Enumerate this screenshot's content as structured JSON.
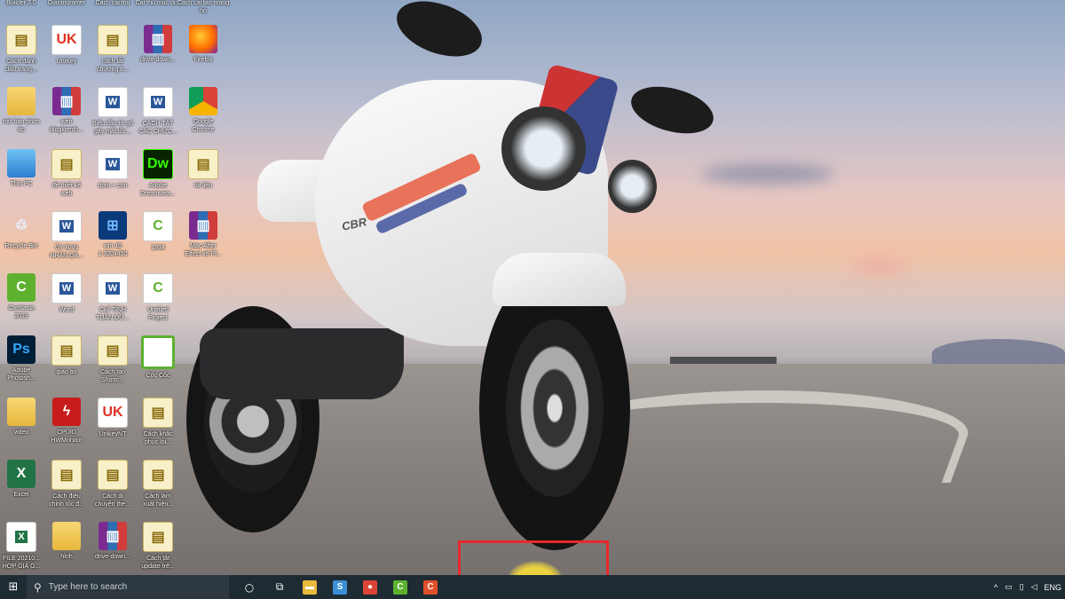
{
  "desktop": {
    "wallpaper": "motorcycle",
    "wallpaper_bike_badge": "CBR",
    "top_partial_labels": [
      "Builder 3.0",
      "Giantnummer",
      "Cach cai thu",
      "Cai thu muc di...",
      "Cach cai tao mang ho"
    ],
    "icons": [
      {
        "label": "Cách đánh\ndấu trang...",
        "icon": "folder-doc-icon"
      },
      {
        "label": "UniKey",
        "icon": "unikey-icon"
      },
      {
        "label": "cách tắt\nchương tr...",
        "icon": "folder-doc-icon"
      },
      {
        "label": "drive-down...",
        "icon": "winrar-icon"
      },
      {
        "label": "Firefox",
        "icon": "firefox-icon"
      },
      {
        "label": "mở bàn phím\nảo",
        "icon": "folder-icon"
      },
      {
        "label": "web\nblogkienth...",
        "icon": "winrar-icon"
      },
      {
        "label": "Biểu đầu từ gõ\ngây mất tốc...",
        "icon": "word-icon"
      },
      {
        "label": "CÁCH TẮT\nCÁC CHỨC...",
        "icon": "word-icon"
      },
      {
        "label": "Google\nChrome",
        "icon": "chrome-icon"
      },
      {
        "label": "This PC",
        "icon": "this-pc-icon"
      },
      {
        "label": "đề thiết kế\nweb",
        "icon": "folder-doc-icon"
      },
      {
        "label": "dom + con",
        "icon": "word-icon"
      },
      {
        "label": "Adobe\nDreamwea...",
        "icon": "dreamweaver-icon"
      },
      {
        "label": "tải liệu",
        "icon": "folder-doc-icon"
      },
      {
        "label": "Recycle Bin",
        "icon": "recycle-bin-icon"
      },
      {
        "label": "ỦY BAN\nNHÂN DÂ...",
        "icon": "word-icon"
      },
      {
        "label": "win 10\n1 920x450",
        "icon": "win10-icon"
      },
      {
        "label": "1934",
        "icon": "camtasia-project-icon"
      },
      {
        "label": "Mac After\nEffect vẽ Pl...",
        "icon": "winrar-icon"
      },
      {
        "label": "Camtasia\n2019",
        "icon": "camtasia-icon"
      },
      {
        "label": "Word",
        "icon": "word-icon"
      },
      {
        "label": "CHỈ TỈNH\nTUẦN DỮ...",
        "icon": "word-icon"
      },
      {
        "label": "Untitled\nProject",
        "icon": "camtasia-project-icon"
      },
      {
        "label": "",
        "icon": "blank"
      },
      {
        "label": "Adobe\nPhotosh...",
        "icon": "photoshop-icon"
      },
      {
        "label": "giao an",
        "icon": "folder-doc-icon"
      },
      {
        "label": "Cách tạo\nShortc...",
        "icon": "folder-doc-icon"
      },
      {
        "label": "Cốc Cốc",
        "icon": "coccoc-icon"
      },
      {
        "label": "",
        "icon": "blank"
      },
      {
        "label": "video",
        "icon": "folder-icon"
      },
      {
        "label": "CPUID\nHWMonitor",
        "icon": "cpuid-icon"
      },
      {
        "label": "UnikeyNT",
        "icon": "unikey-icon"
      },
      {
        "label": "Cách khắc\nphục lỗi...",
        "icon": "folder-doc-icon"
      },
      {
        "label": "",
        "icon": "blank"
      },
      {
        "label": "Excel",
        "icon": "excel-icon"
      },
      {
        "label": "Cách điều\nchỉnh tốc đ...",
        "icon": "folder-doc-icon"
      },
      {
        "label": "Cách di\nchuyển the...",
        "icon": "folder-doc-icon"
      },
      {
        "label": "Cách làm\nxuất hiện...",
        "icon": "folder-doc-icon"
      },
      {
        "label": "",
        "icon": "blank"
      },
      {
        "label": "FILE 20210...\nHỢP GIÁ G...",
        "icon": "excel-file-icon"
      },
      {
        "label": "hình",
        "icon": "folder-icon"
      },
      {
        "label": "drive-down...",
        "icon": "winrar-icon"
      },
      {
        "label": "Cách tắt\nupdate trê...",
        "icon": "folder-doc-icon"
      }
    ]
  },
  "taskbar": {
    "search_placeholder": "Type here to search",
    "pinned": [
      {
        "name": "cortana",
        "glyph": "○"
      },
      {
        "name": "task-view",
        "glyph": "⧉"
      },
      {
        "name": "file-explorer",
        "glyph": "▬",
        "color": "#e8b93b"
      },
      {
        "name": "app-s",
        "glyph": "S",
        "color": "#3a8fd6"
      },
      {
        "name": "chrome",
        "glyph": "●",
        "color": "#db4437"
      },
      {
        "name": "camtasia",
        "glyph": "C",
        "color": "#5db12f"
      },
      {
        "name": "camtasia-recorder",
        "glyph": "C",
        "color": "#e0502a"
      }
    ],
    "tray": {
      "chevron": "^",
      "lang": "ENG"
    }
  },
  "annotation": {
    "highlight_color": "#e8282d"
  }
}
